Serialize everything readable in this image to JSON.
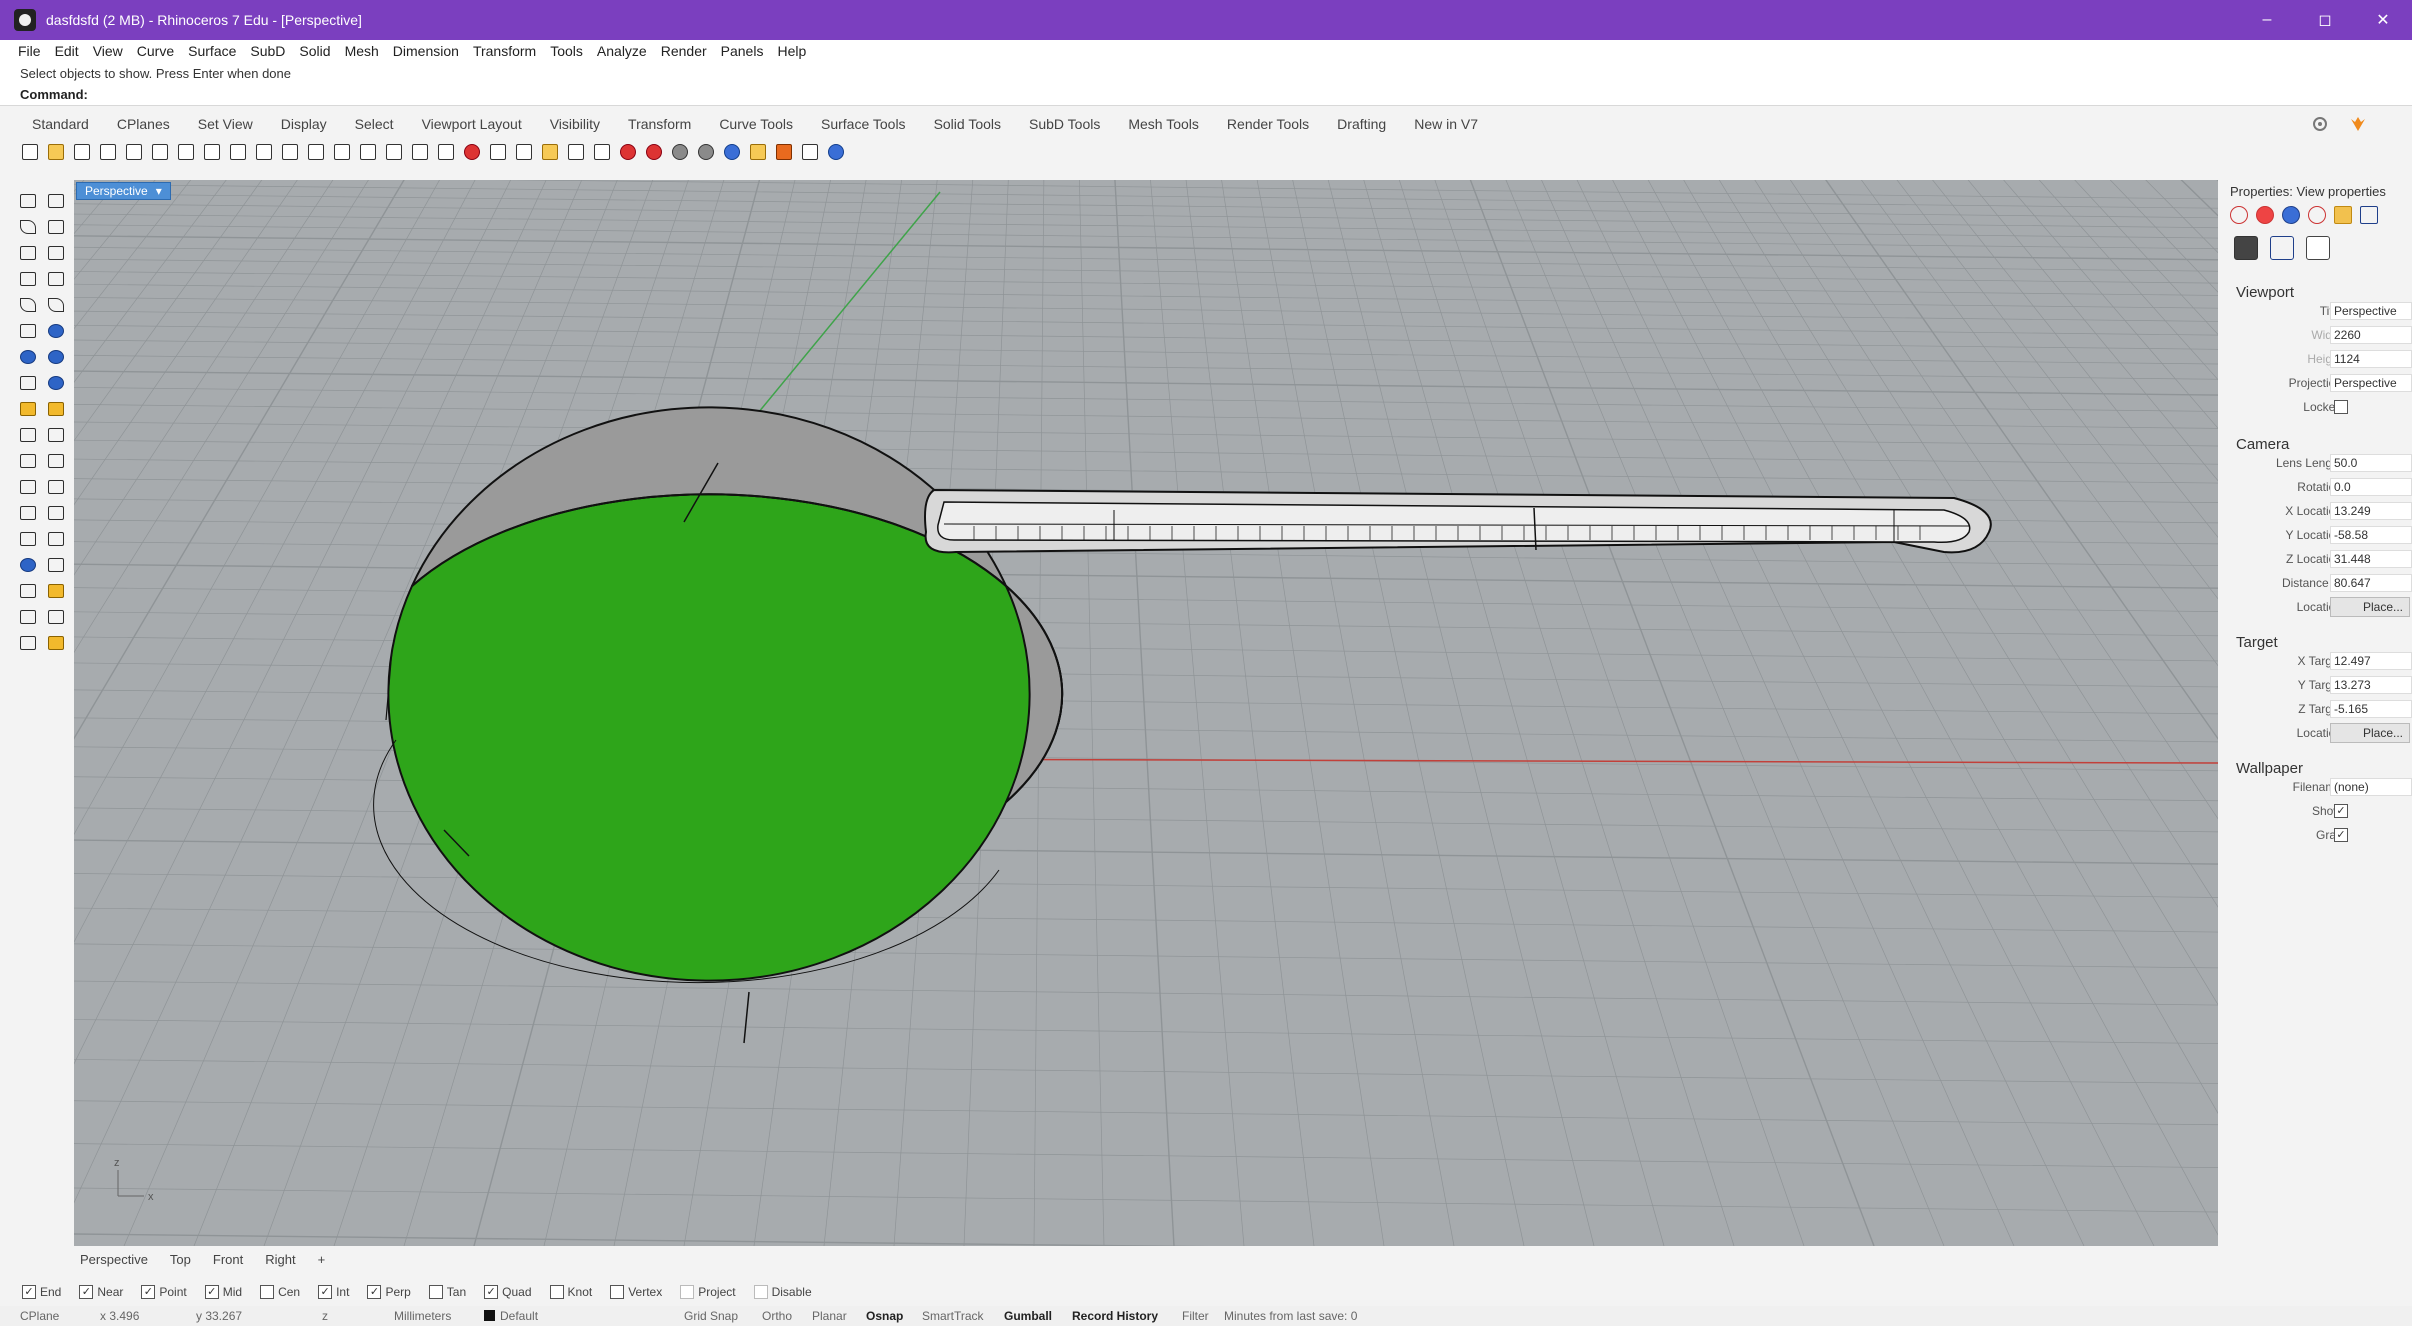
{
  "window": {
    "title": "dasfdsfd (2 MB) - Rhinoceros 7 Edu - [Perspective]",
    "minimize_glyph": "–",
    "maximize_glyph": "◻",
    "close_glyph": "✕"
  },
  "menu": [
    "File",
    "Edit",
    "View",
    "Curve",
    "Surface",
    "SubD",
    "Solid",
    "Mesh",
    "Dimension",
    "Transform",
    "Tools",
    "Analyze",
    "Render",
    "Panels",
    "Help"
  ],
  "command": {
    "history": "Select objects to show. Press Enter when done",
    "prompt": "Command:",
    "value": ""
  },
  "toolbar_tabs": [
    "Standard",
    "CPlanes",
    "Set View",
    "Display",
    "Select",
    "Viewport Layout",
    "Visibility",
    "Transform",
    "Curve Tools",
    "Surface Tools",
    "Solid Tools",
    "SubD Tools",
    "Mesh Tools",
    "Render Tools",
    "Drafting",
    "New in V7"
  ],
  "viewport": {
    "title": "Perspective",
    "menu_glyph": "▾",
    "tabs": [
      "Perspective",
      "Top",
      "Front",
      "Right"
    ],
    "add_glyph": "+",
    "colors": {
      "background": "#a7abae",
      "grid": "#8f9497",
      "axis_x": "#c2403a",
      "axis_y": "#3fa34a",
      "surface_green": "#2ea51a",
      "surface_gray": "#9a9a9a"
    },
    "axis_labels": {
      "x": "x",
      "z": "z"
    }
  },
  "osnap": {
    "items": [
      {
        "label": "End",
        "checked": true
      },
      {
        "label": "Near",
        "checked": true
      },
      {
        "label": "Point",
        "checked": true
      },
      {
        "label": "Mid",
        "checked": true
      },
      {
        "label": "Cen",
        "checked": false
      },
      {
        "label": "Int",
        "checked": true
      },
      {
        "label": "Perp",
        "checked": true
      },
      {
        "label": "Tan",
        "checked": false
      },
      {
        "label": "Quad",
        "checked": true
      },
      {
        "label": "Knot",
        "checked": false
      },
      {
        "label": "Vertex",
        "checked": false
      },
      {
        "label": "Project",
        "checked": false
      },
      {
        "label": "Disable",
        "checked": false
      }
    ]
  },
  "status": {
    "cplane": "CPlane",
    "x": "x 3.496",
    "y": "y 33.267",
    "z": "z",
    "units": "Millimeters",
    "layer": "Default",
    "grid_snap": "Grid Snap",
    "ortho": "Ortho",
    "planar": "Planar",
    "osnap": "Osnap",
    "smarttrack": "SmartTrack",
    "gumball": "Gumball",
    "record_history": "Record History",
    "filter": "Filter",
    "minutes": "Minutes from last save: 0"
  },
  "panel": {
    "title": "Properties: View properties",
    "viewport": {
      "heading": "Viewport",
      "title_label": "Title",
      "title_value": "Perspective",
      "width_label": "Width",
      "width_value": "2260",
      "height_label": "Height",
      "height_value": "1124",
      "projection_label": "Projection",
      "projection_value": "Perspective",
      "locked_label": "Locked",
      "locked_checked": false
    },
    "camera": {
      "heading": "Camera",
      "lens_label": "Lens Leng...",
      "lens_value": "50.0",
      "rotation_label": "Rotation",
      "rotation_value": "0.0",
      "xloc_label": "X Location",
      "xloc_value": "13.249",
      "yloc_label": "Y Location",
      "yloc_value": "-58.58",
      "zloc_label": "Z Location",
      "zloc_value": "31.448",
      "distance_label": "Distance ...",
      "distance_value": "80.647",
      "location_label": "Location",
      "location_button": "Place..."
    },
    "target": {
      "heading": "Target",
      "xt_label": "X Target",
      "xt_value": "12.497",
      "yt_label": "Y Target",
      "yt_value": "13.273",
      "zt_label": "Z Target",
      "zt_value": "-5.165",
      "location_label": "Location",
      "location_button": "Place..."
    },
    "wallpaper": {
      "heading": "Wallpaper",
      "filename_label": "Filename",
      "filename_value": "(none)",
      "show_label": "Show",
      "show_checked": true,
      "gray_label": "Gray",
      "gray_checked": true
    }
  }
}
